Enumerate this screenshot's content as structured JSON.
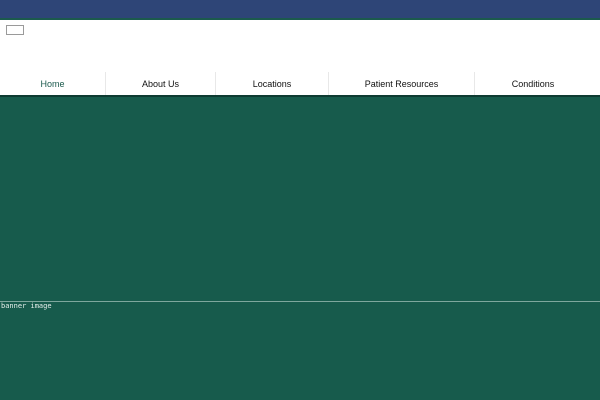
{
  "nav": {
    "items": [
      {
        "label": "Home",
        "active": true
      },
      {
        "label": "About Us",
        "active": false
      },
      {
        "label": "Locations",
        "active": false
      },
      {
        "label": "Patient Resources",
        "active": false
      },
      {
        "label": "Conditions",
        "active": false
      }
    ]
  },
  "banner": {
    "alt_text": "banner image",
    "color": "#175b4c"
  },
  "colors": {
    "top_bar": "#2e4577",
    "accent": "#1b5a4d"
  }
}
